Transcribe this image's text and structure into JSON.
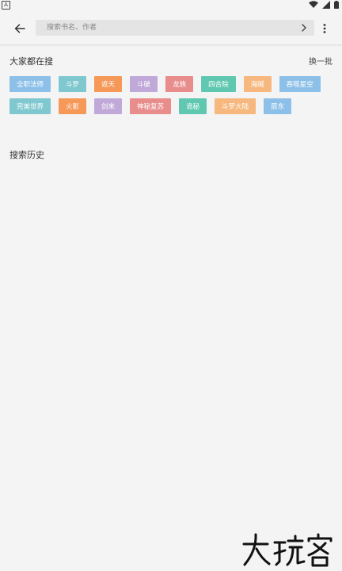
{
  "status_bar": {
    "left_icon": "A"
  },
  "search": {
    "placeholder": "搜索书名、作者",
    "value": ""
  },
  "hot": {
    "title": "大家都在搜",
    "refresh_label": "换一批",
    "tags": [
      {
        "label": "全职法师",
        "color": "#8cc0e8"
      },
      {
        "label": "斗罗",
        "color": "#80c8d0"
      },
      {
        "label": "遮天",
        "color": "#f59858"
      },
      {
        "label": "斗破",
        "color": "#c0a8d8"
      },
      {
        "label": "龙族",
        "color": "#e88c8c"
      },
      {
        "label": "四合院",
        "color": "#60c8b0"
      },
      {
        "label": "海贼",
        "color": "#f6b87e"
      },
      {
        "label": "吞噬星空",
        "color": "#8cc0e8"
      },
      {
        "label": "完美世界",
        "color": "#80c8d0"
      },
      {
        "label": "火影",
        "color": "#f59858"
      },
      {
        "label": "剑来",
        "color": "#c0a8d8"
      },
      {
        "label": "神秘复苏",
        "color": "#e88c8c"
      },
      {
        "label": "诡秘",
        "color": "#60c8b0"
      },
      {
        "label": "斗罗大陆",
        "color": "#f6b87e"
      },
      {
        "label": "辰东",
        "color": "#8cc0e8"
      }
    ]
  },
  "history": {
    "title": "搜索历史"
  },
  "watermark": {
    "text": "大玩客"
  }
}
